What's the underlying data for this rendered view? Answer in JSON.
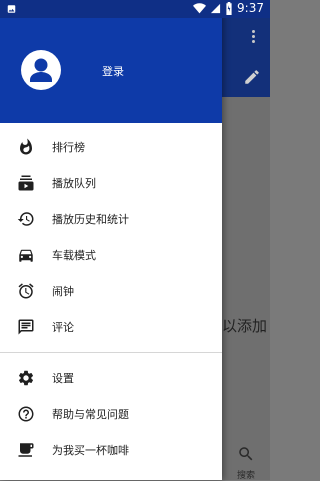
{
  "status_bar": {
    "time": "9:37"
  },
  "drawer": {
    "header": {
      "login_label": "登录"
    },
    "primary_items": [
      {
        "label": "排行榜",
        "icon": "fire-icon"
      },
      {
        "label": "播放队列",
        "icon": "queue-icon"
      },
      {
        "label": "播放历史和统计",
        "icon": "history-icon"
      },
      {
        "label": "车载模式",
        "icon": "car-icon"
      },
      {
        "label": "闹钟",
        "icon": "alarm-icon"
      },
      {
        "label": "评论",
        "icon": "comment-icon"
      }
    ],
    "secondary_items": [
      {
        "label": "设置",
        "icon": "gear-icon"
      },
      {
        "label": "帮助与常见问题",
        "icon": "help-icon"
      },
      {
        "label": "为我买一杯咖啡",
        "icon": "coffee-icon"
      }
    ]
  },
  "background": {
    "partial_text": "以添加",
    "search_label": "搜索"
  },
  "colors": {
    "primary": "#0e3aa8",
    "statusbar": "#0f2f86",
    "icon": "#202020"
  }
}
